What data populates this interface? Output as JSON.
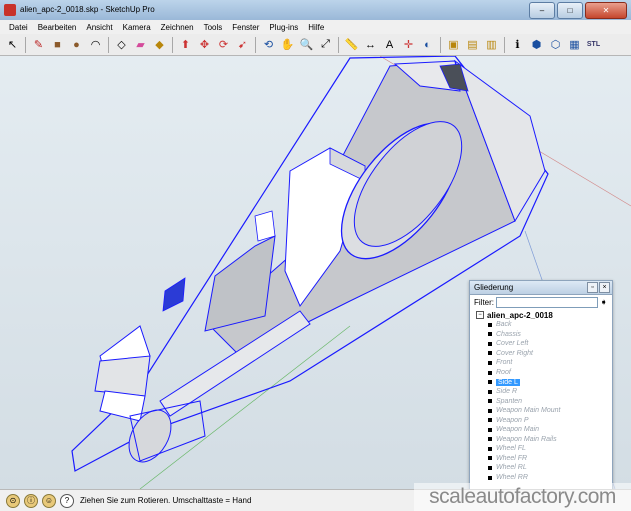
{
  "window": {
    "title": "alien_apc-2_0018.skp - SketchUp Pro",
    "controls": [
      "–",
      "□",
      "✕"
    ]
  },
  "menu": [
    "Datei",
    "Bearbeiten",
    "Ansicht",
    "Kamera",
    "Zeichnen",
    "Tools",
    "Fenster",
    "Plug-ins",
    "Hilfe"
  ],
  "toolbar": {
    "tools": [
      {
        "name": "select-tool-icon",
        "glyph": "↖"
      },
      {
        "name": "pencil-tool-icon",
        "glyph": "✎"
      },
      {
        "name": "rectangle-tool-icon",
        "glyph": "■"
      },
      {
        "name": "circle-tool-icon",
        "glyph": "●"
      },
      {
        "name": "arc-tool-icon",
        "glyph": "◠"
      },
      {
        "name": "make-component-icon",
        "glyph": "◇"
      },
      {
        "name": "eraser-tool-icon",
        "glyph": "▰"
      },
      {
        "name": "paint-bucket-icon",
        "glyph": "◆"
      },
      {
        "name": "push-pull-icon",
        "glyph": "⬆"
      },
      {
        "name": "move-tool-icon",
        "glyph": "✥"
      },
      {
        "name": "rotate-tool-icon",
        "glyph": "⟳"
      },
      {
        "name": "follow-me-icon",
        "glyph": "➹"
      },
      {
        "name": "orbit-tool-icon",
        "glyph": "⟲"
      },
      {
        "name": "pan-tool-icon",
        "glyph": "✋"
      },
      {
        "name": "zoom-tool-icon",
        "glyph": "🔍"
      },
      {
        "name": "zoom-extents-icon",
        "glyph": "⤢"
      },
      {
        "name": "tape-measure-icon",
        "glyph": "📏"
      },
      {
        "name": "dimension-tool-icon",
        "glyph": "↔"
      },
      {
        "name": "text-tool-icon",
        "glyph": "A"
      },
      {
        "name": "axes-tool-icon",
        "glyph": "✛"
      },
      {
        "name": "section-plane-icon",
        "glyph": "◐"
      },
      {
        "name": "get-models-icon",
        "glyph": "▣"
      },
      {
        "name": "share-model-icon",
        "glyph": "▤"
      },
      {
        "name": "share-component-icon",
        "glyph": "▥"
      },
      {
        "name": "model-info-icon",
        "glyph": "ℹ"
      },
      {
        "name": "iso-view-icon",
        "glyph": "⬢"
      },
      {
        "name": "top-view-icon",
        "glyph": "⬡"
      },
      {
        "name": "components-window-icon",
        "glyph": "▦"
      },
      {
        "name": "export-stl-icon",
        "glyph": "STL"
      }
    ]
  },
  "outliner": {
    "title": "Gliederung",
    "filter_label": "Filter:",
    "filter_value": "",
    "root": "alien_apc-2_0018",
    "items": [
      "Back",
      "Chassis",
      "Cover Left",
      "Cover Right",
      "Front",
      "Roof",
      "Side L",
      "Side R",
      "Spanten",
      "Weapon Main Mount",
      "Weapon P",
      "Weapon Main",
      "Weapon Main Rails",
      "Wheel FL",
      "Wheel FR",
      "Wheel RL",
      "Wheel RR"
    ],
    "selected": "Side L"
  },
  "status": {
    "text": "Ziehen Sie zum Rotieren.  Umschalttaste = Hand"
  },
  "watermark": "scaleautofactory.com",
  "colors": {
    "edge_blue": "#1a1aff",
    "face_white": "#ffffff",
    "face_grey": "#c6c8cc",
    "selection": "#3399ff"
  }
}
